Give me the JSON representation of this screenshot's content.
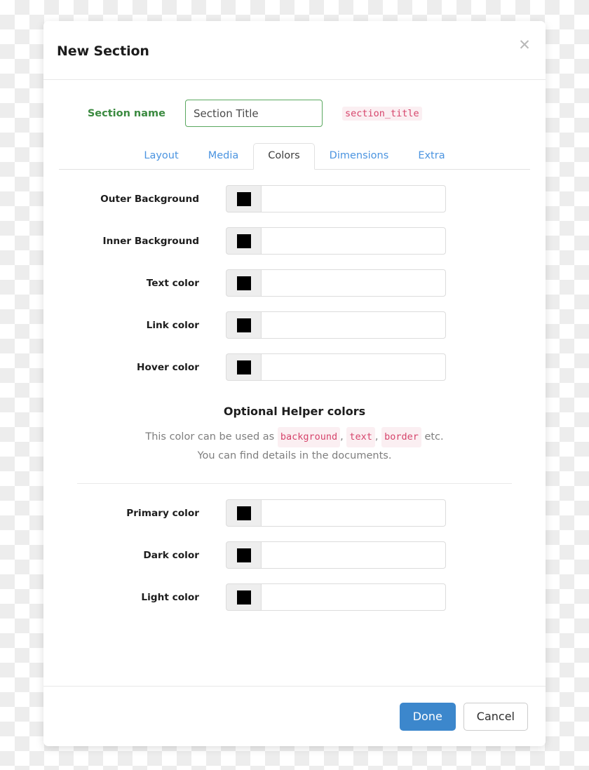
{
  "dialog": {
    "title": "New Section",
    "close_icon": "close-icon"
  },
  "section_name": {
    "label": "Section name",
    "value": "Section Title",
    "placeholder": "Section Title",
    "code_badge": "section_title",
    "label_color": "#3b8a40",
    "border_color": "#5aa85f"
  },
  "tabs": [
    {
      "label": "Layout",
      "active": false
    },
    {
      "label": "Media",
      "active": false
    },
    {
      "label": "Colors",
      "active": true
    },
    {
      "label": "Dimensions",
      "active": false
    },
    {
      "label": "Extra",
      "active": false
    }
  ],
  "tab_colors": {
    "inactive": "#4b94e0",
    "active": "#3c3c3c"
  },
  "color_fields": [
    {
      "label": "Outer Background",
      "swatch": "#000000",
      "value": "",
      "placeholder": ""
    },
    {
      "label": "Inner Background",
      "swatch": "#000000",
      "value": "",
      "placeholder": ""
    },
    {
      "label": "Text color",
      "swatch": "#000000",
      "value": "",
      "placeholder": ""
    },
    {
      "label": "Link color",
      "swatch": "#000000",
      "value": "",
      "placeholder": ""
    },
    {
      "label": "Hover color",
      "swatch": "#000000",
      "value": "",
      "placeholder": ""
    }
  ],
  "helper": {
    "title": "Optional Helper colors",
    "line1_start": "This color can be used as",
    "code1": "background",
    "sep1": ",",
    "code2": "text",
    "sep2": ",",
    "code3": "border",
    "line1_end": "etc.",
    "line2": "You can find details in the documents."
  },
  "helper_color_fields": [
    {
      "label": "Primary color",
      "swatch": "#000000",
      "value": "",
      "placeholder": ""
    },
    {
      "label": "Dark color",
      "swatch": "#000000",
      "value": "",
      "placeholder": ""
    },
    {
      "label": "Light color",
      "swatch": "#000000",
      "value": "",
      "placeholder": ""
    }
  ],
  "footer": {
    "done_label": "Done",
    "cancel_label": "Cancel",
    "primary_color": "#3c87cc"
  },
  "code_badge_style": {
    "text_color": "#d6446b",
    "background_color": "#fbeff2"
  }
}
